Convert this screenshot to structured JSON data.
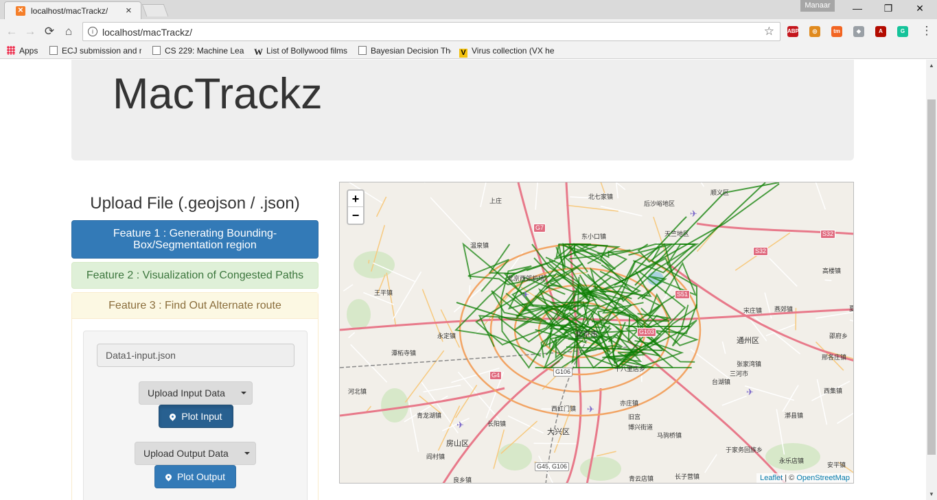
{
  "browser": {
    "tab_title": "localhost/macTrackz/",
    "tab_close": "×",
    "profile_name": "Manaar",
    "url": "localhost/macTrackz/",
    "window_controls": [
      "—",
      "❐",
      "✕"
    ],
    "bookmarks": [
      {
        "label": "Apps",
        "icon": "apps-icon"
      },
      {
        "label": "ECJ submission and re",
        "icon": "doc-icon"
      },
      {
        "label": "CS 229: Machine Lear",
        "icon": "doc-icon"
      },
      {
        "label": "List of Bollywood films",
        "icon": "wiki-icon"
      },
      {
        "label": "Bayesian Decision The",
        "icon": "doc-icon"
      },
      {
        "label": "Virus collection (VX he",
        "icon": "v-icon"
      }
    ],
    "extensions": [
      {
        "name": "adblock-icon",
        "label": "ABP",
        "color": "#c4151c"
      },
      {
        "name": "extension-orange-icon",
        "label": "◎",
        "color": "#e08a1e"
      },
      {
        "name": "tm-icon",
        "label": "tm",
        "color": "#f26522"
      },
      {
        "name": "cube-icon",
        "label": "◆",
        "color": "#9aa0a6"
      },
      {
        "name": "pdf-icon",
        "label": "A",
        "color": "#b30b00"
      },
      {
        "name": "grammarly-icon",
        "label": "G",
        "color": "#15c39a"
      }
    ]
  },
  "page": {
    "title": "MacTrackz",
    "upload_title": "Upload File (.geojson / .json)",
    "feature1": "Feature 1 : Generating Bounding-Box/Segmentation region",
    "feature2": "Feature 2 : Visualization of Congested Paths",
    "feature3": "Feature 3 : Find Out Alternate route",
    "file_value": "Data1-input.json",
    "upload_input_label": "Upload Input Data",
    "plot_input_label": "Plot Input",
    "upload_output_label": "Upload Output Data",
    "plot_output_label": "Plot Output"
  },
  "map": {
    "zoom_in": "+",
    "zoom_out": "−",
    "attribution_leaflet": "Leaflet",
    "attribution_sep": " | © ",
    "attribution_osm": "OpenStreetMap",
    "track_color": "#0a7d00",
    "labels": [
      "上庄",
      "北七家镇",
      "后沙峪地区",
      "顺义区",
      "温泉镇",
      "东小口镇",
      "天竺地区",
      "北京西郊机场",
      "王平镇",
      "永定镇",
      "北京市",
      "宋庄镇",
      "燕郊镇",
      "通州区",
      "潭柘寺镇",
      "十八里店乡",
      "张家湾镇",
      "台湖镇",
      "河北镇",
      "亦庄镇",
      "西红门镇",
      "青龙湖镇",
      "长阳镇",
      "大兴区",
      "旧宫",
      "博兴街道",
      "马驹桥镇",
      "房山区",
      "阎村镇",
      "良乡镇",
      "青云店镇",
      "长子营镇",
      "于家务回族乡",
      "永乐店镇",
      "安平镇",
      "西集镇",
      "漷县镇",
      "高楼镇",
      "邵府乡",
      "邢各庄镇",
      "夏垫",
      "三河市"
    ],
    "shields": [
      "G7",
      "S32",
      "S32",
      "S51",
      "G4",
      "G106",
      "G103",
      "G45, G106"
    ]
  }
}
